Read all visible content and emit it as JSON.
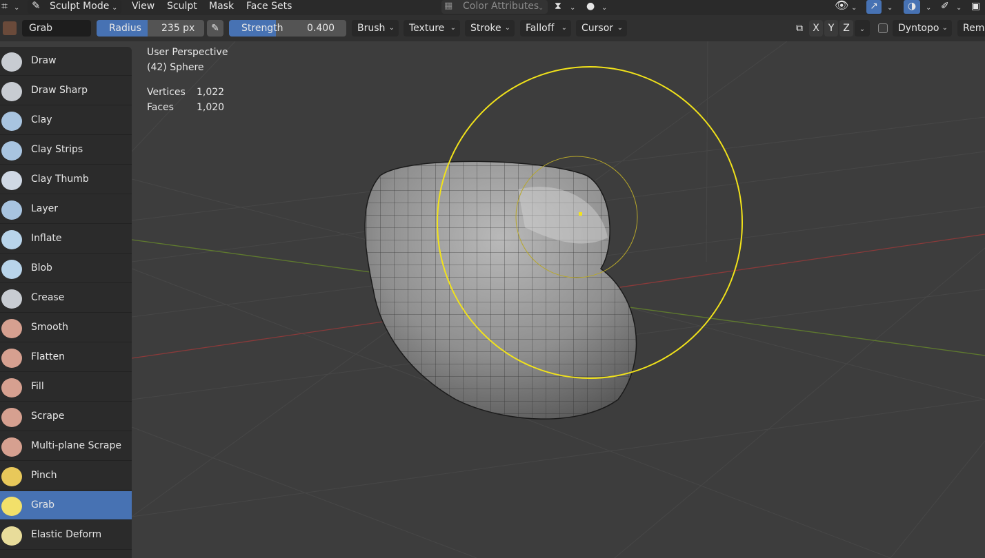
{
  "header": {
    "mode": "Sculpt Mode",
    "menus": [
      "View",
      "Sculpt",
      "Mask",
      "Face Sets"
    ],
    "color_attributes": "Color Attributes"
  },
  "tool_settings": {
    "brush_name": "Grab",
    "radius_label": "Radius",
    "radius_value": "235 px",
    "strength_label": "Strength",
    "strength_value": "0.400",
    "strength_fraction": 0.4,
    "dropdowns": [
      "Brush",
      "Texture",
      "Stroke",
      "Falloff",
      "Cursor"
    ],
    "axes": [
      "X",
      "Y",
      "Z"
    ],
    "dyntopo": "Dyntopo",
    "remesh": "Rem"
  },
  "viewport": {
    "view_name": "User Perspective",
    "object_name": "(42) Sphere",
    "vertices_label": "Vertices",
    "vertices_value": "1,022",
    "faces_label": "Faces",
    "faces_value": "1,020"
  },
  "tools": [
    {
      "label": "Draw"
    },
    {
      "label": "Draw Sharp"
    },
    {
      "label": "Clay"
    },
    {
      "label": "Clay Strips"
    },
    {
      "label": "Clay Thumb"
    },
    {
      "label": "Layer"
    },
    {
      "label": "Inflate"
    },
    {
      "label": "Blob"
    },
    {
      "label": "Crease"
    },
    {
      "label": "Smooth"
    },
    {
      "label": "Flatten"
    },
    {
      "label": "Fill"
    },
    {
      "label": "Scrape"
    },
    {
      "label": "Multi-plane Scrape"
    },
    {
      "label": "Pinch"
    },
    {
      "label": "Grab"
    },
    {
      "label": "Elastic Deform"
    }
  ],
  "active_tool": "Grab",
  "colors": {
    "accent": "#4772b3",
    "brush_circle": "#f2e31a",
    "axis_x": "#8a3a3a",
    "axis_y": "#5f7a2e"
  }
}
